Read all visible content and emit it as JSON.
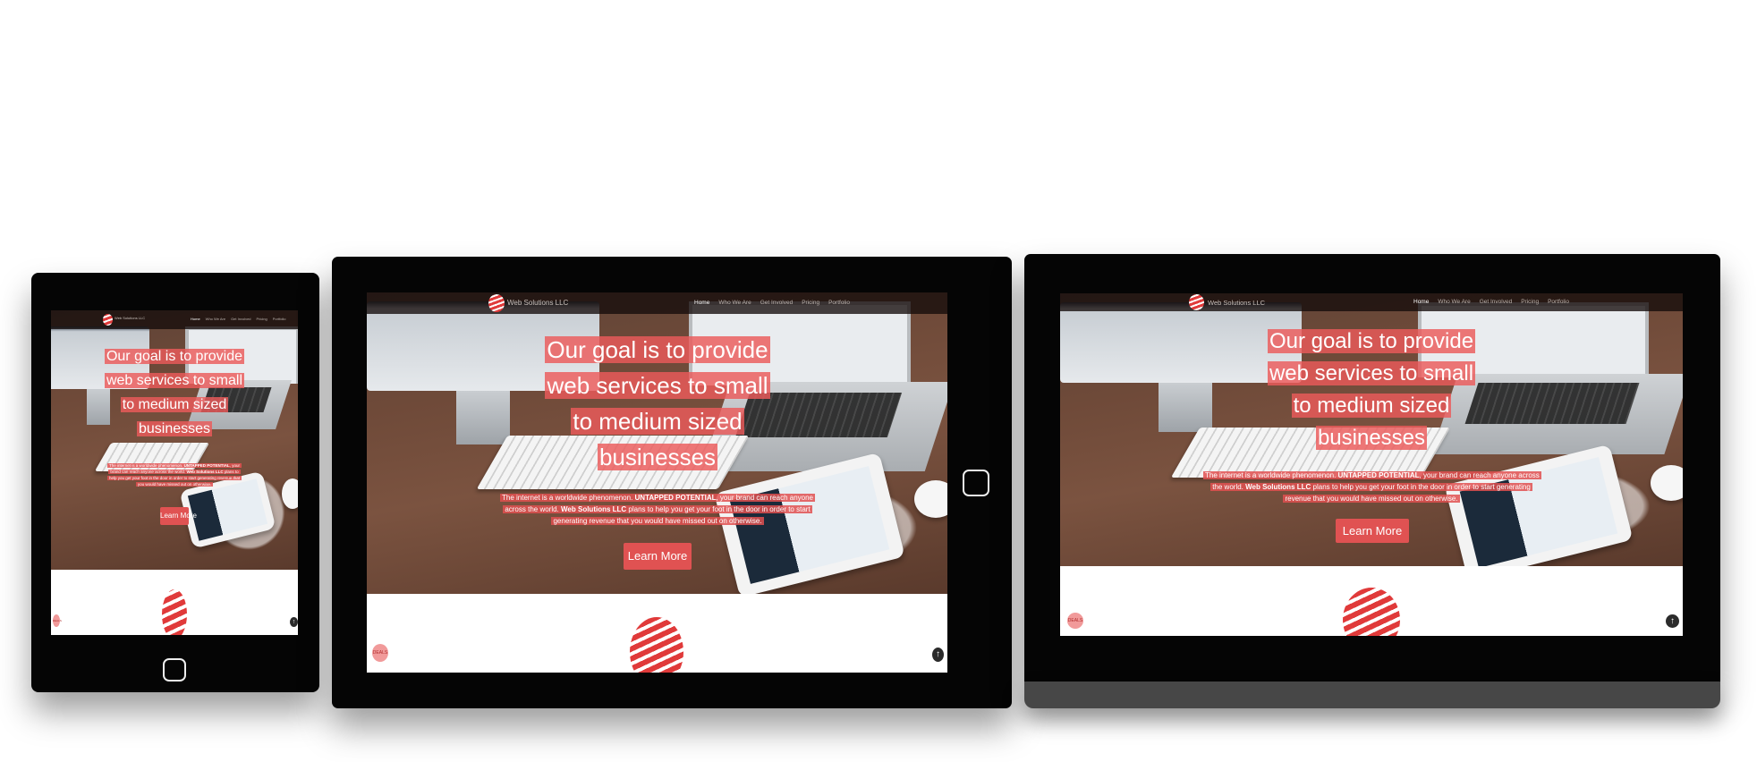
{
  "site": {
    "brand": "Web Solutions LLC",
    "nav": [
      {
        "label": "Home",
        "active": true
      },
      {
        "label": "Who We Are",
        "active": false
      },
      {
        "label": "Get Involved",
        "active": false
      },
      {
        "label": "Pricing",
        "active": false
      },
      {
        "label": "Portfolio",
        "active": false
      }
    ],
    "headline": {
      "line1": "Our goal is to provide",
      "line2": "web services to small",
      "line3": "to medium sized",
      "line4": "businesses"
    },
    "subtext": {
      "part1": "The internet is a worldwide phenomenon. ",
      "emph1": "UNTAPPED POTENTIAL",
      "part2": ", your brand can reach anyone across the world. ",
      "emph2": "Web Solutions LLC",
      "part3": " plans to help you get your foot in the door in order to start generating revenue that you would have missed out on otherwise."
    },
    "cta_label": "Learn More",
    "deals_label": "DEALS",
    "up_icon": "arrow-up-circle-icon"
  },
  "colors": {
    "accent": "#e05252",
    "navbar": "#140c0a",
    "device_frame": "#050505",
    "laptop_lip": "#474747"
  }
}
